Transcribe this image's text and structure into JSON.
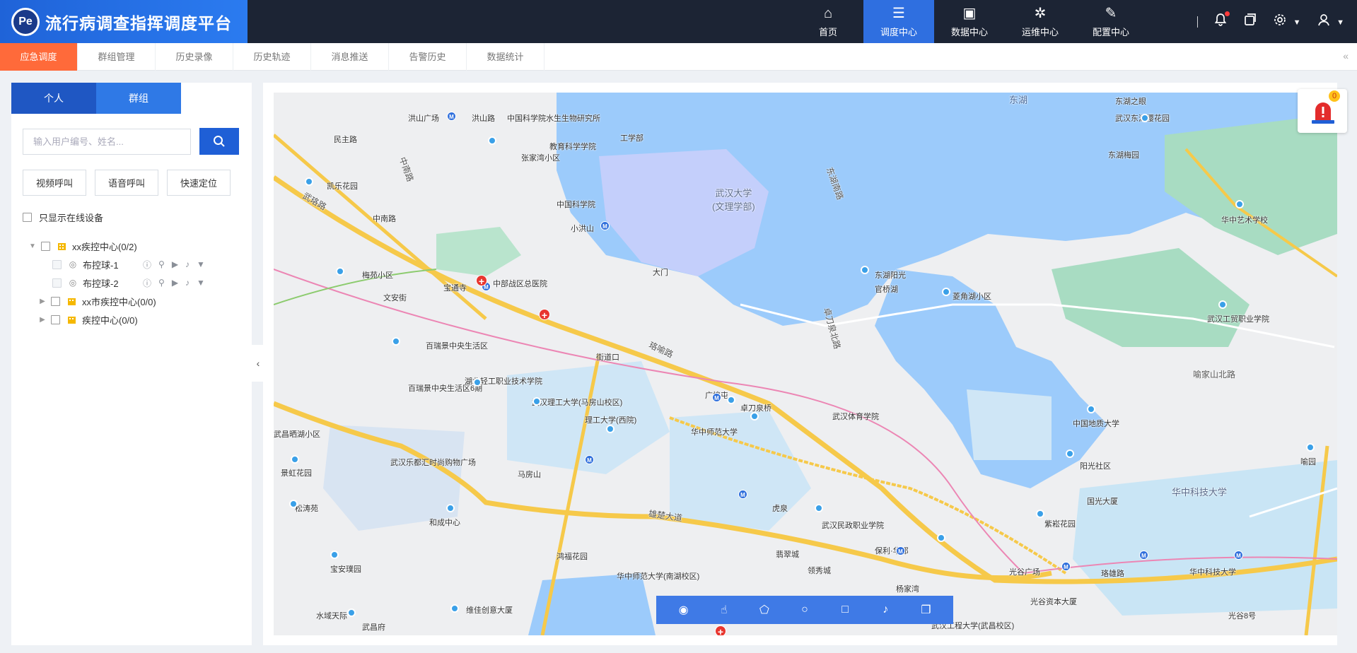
{
  "app": {
    "logo_text": "Pe",
    "title": "流行病调查指挥调度平台"
  },
  "nav": [
    {
      "label": "首页",
      "icon": "home-icon",
      "glyph": "⌂"
    },
    {
      "label": "调度中心",
      "icon": "sliders-icon",
      "glyph": "☰"
    },
    {
      "label": "数据中心",
      "icon": "monitor-icon",
      "glyph": "▣"
    },
    {
      "label": "运维中心",
      "icon": "cluster-icon",
      "glyph": "✲"
    },
    {
      "label": "配置中心",
      "icon": "wrench-icon",
      "glyph": "✎"
    }
  ],
  "active_nav": "调度中心",
  "subtabs": [
    "应急调度",
    "群组管理",
    "历史录像",
    "历史轨迹",
    "消息推送",
    "告警历史",
    "数据统计"
  ],
  "active_subtab": "应急调度",
  "panel": {
    "tabs": [
      "个人",
      "群组"
    ],
    "search_placeholder": "输入用户编号、姓名...",
    "buttons": [
      "视频呼叫",
      "语音呼叫",
      "快速定位"
    ],
    "online_only_label": "只显示在线设备",
    "tree": [
      {
        "label": "xx疾控中心(0/2)",
        "expanded": true,
        "children": [
          "布控球-1",
          "布控球-2"
        ]
      },
      {
        "label": "xx市疾控中心(0/0)",
        "expanded": false
      },
      {
        "label": "疾控中心(0/0)",
        "expanded": false
      }
    ]
  },
  "alarm": {
    "count": "0"
  },
  "map_labels": {
    "lake": "东湖",
    "whu": "武汉大学\n(文理学部)",
    "hust": "华中科技大学",
    "roads": [
      "中南路",
      "武珞路",
      "珞喻路",
      "雄楚大道",
      "喻家山北路",
      "东湖南路",
      "卓刀泉北路"
    ],
    "places": [
      "洪山广场",
      "洪山路",
      "中国科学院水生生物研究所",
      "教育科学学院",
      "工学部",
      "张家湾小区",
      "中国科学院",
      "小洪山",
      "凯乐花园",
      "民主路",
      "中南路",
      "梅苑小区",
      "宝通寺",
      "中部战区总医院",
      "文安街",
      "街道口",
      "百瑞景中央生活区",
      "百瑞景中央生活区6期",
      "湖北轻工职业技术学院",
      "武汉理工大学(马房山校区)",
      "理工大学(西院)",
      "华中师范大学",
      "广埠屯",
      "卓刀泉桥",
      "武汉体育学院",
      "东湖阳光",
      "官桥湖",
      "菱角湖小区",
      "东湖之眼",
      "武汉东湖樱花园",
      "东湖梅园",
      "华中艺术学校",
      "武汉工贸职业学院",
      "中国地质大学",
      "阳光社区",
      "国光大厦",
      "紫崧花园",
      "武昌晒湖小区",
      "景虹花园",
      "武汉乐都汇时尚购物广场",
      "马房山",
      "松涛苑",
      "和成中心",
      "鸿福花园",
      "华中师范大学(南湖校区)",
      "虎泉",
      "武汉民政职业学院",
      "翡翠城",
      "领秀城",
      "杨家湾",
      "保利·华都",
      "光谷广场",
      "珞雄路",
      "光谷资本大厦",
      "华中科技大学",
      "光谷8号",
      "宝安璞园",
      "水域天际",
      "武昌府",
      "维佳创意大厦",
      "武汉工程大学(武昌校区)",
      "喻园",
      "大门"
    ]
  },
  "map_tools": [
    {
      "name": "eye-icon",
      "glyph": "◉"
    },
    {
      "name": "hand-icon",
      "glyph": "☝"
    },
    {
      "name": "polygon-icon",
      "glyph": "⬠"
    },
    {
      "name": "circle-icon",
      "glyph": "○"
    },
    {
      "name": "rectangle-icon",
      "glyph": "□"
    },
    {
      "name": "microphone-icon",
      "glyph": "♪"
    },
    {
      "name": "layers-icon",
      "glyph": "❐"
    }
  ],
  "colors": {
    "brand": "#2b7bf0",
    "topbar": "#1c2434",
    "accent": "#ff6a3a",
    "active_nav": "#2f6fe0"
  }
}
